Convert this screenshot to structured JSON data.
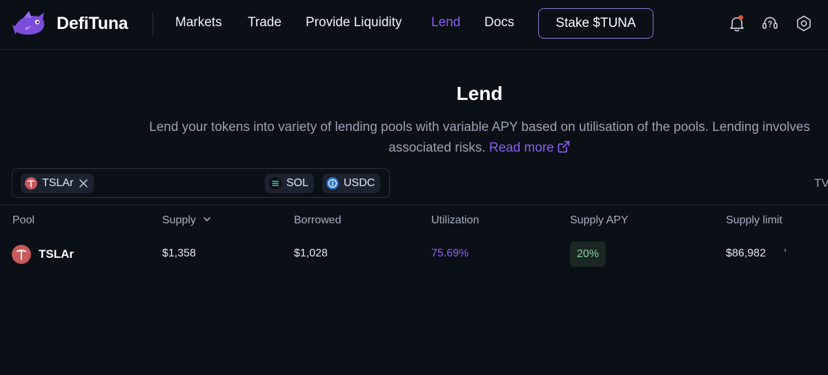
{
  "brand": {
    "name": "DefiTuna"
  },
  "nav": {
    "markets": "Markets",
    "trade": "Trade",
    "provide_liquidity": "Provide Liquidity",
    "lend": "Lend",
    "docs": "Docs"
  },
  "stake_button": "Stake $TUNA",
  "header_icons": [
    "bell-icon",
    "support-headset-icon",
    "settings-hexagon-icon"
  ],
  "page": {
    "title": "Lend",
    "description_line1": "Lend your tokens into variety of lending pools with variable APY based on utilisation of the pools. Lending involves",
    "description_line2": "associated risks.",
    "read_more": "Read more"
  },
  "filters": {
    "selected": {
      "label": "TSLAr"
    },
    "options": [
      {
        "label": "SOL"
      },
      {
        "label": "USDC"
      }
    ],
    "tvl_label": "TV"
  },
  "table": {
    "columns": [
      "Pool",
      "Supply",
      "Borrowed",
      "Utilization",
      "Supply APY",
      "Supply limit"
    ],
    "rows": [
      {
        "pool": "TSLAr",
        "supply": "$1,358",
        "borrowed": "$1,028",
        "utilization": "75.69%",
        "supply_apy": "20%",
        "supply_limit": "$86,982"
      }
    ]
  },
  "colors": {
    "background": "#0b0f16",
    "accent": "#8b5cf6",
    "apy_green": "#7ed6a0",
    "notification": "#e2553c"
  }
}
